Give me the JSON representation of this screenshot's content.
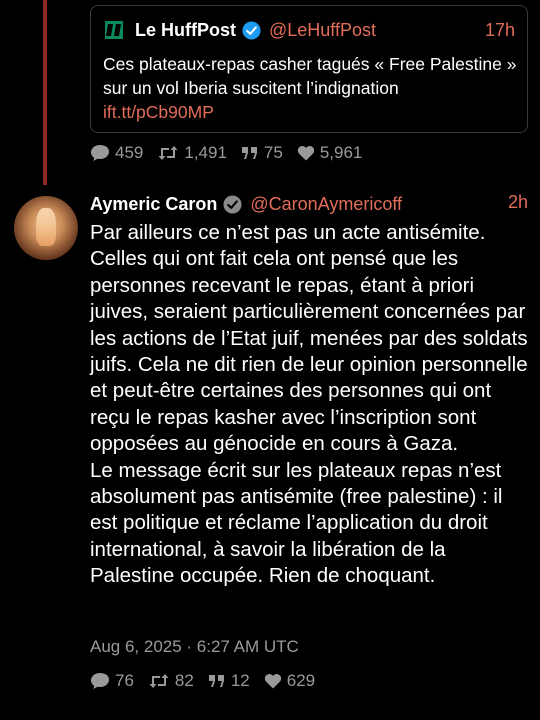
{
  "quoted": {
    "name": "Le HuffPost",
    "handle": "@LeHuffPost",
    "time": "17h",
    "text": "Ces plateaux-repas casher tagués « Free Palestine » sur un vol Iberia suscitent l’indignation",
    "link": "ift.tt/pCb90MP",
    "stats": {
      "replies": "459",
      "retweets": "1,491",
      "quotes": "75",
      "likes": "5,961"
    }
  },
  "post": {
    "name": "Aymeric Caron",
    "handle": "@CaronAymericoff",
    "time": "2h",
    "text": "Par ailleurs ce n’est pas un acte antisémite. Celles qui ont fait cela ont pensé que les personnes recevant le repas, étant à priori juives, seraient particulièrement concernées par les actions de l’Etat juif, menées par des soldats juifs. Cela ne dit rien de leur opinion personnelle et peut-être certaines des personnes qui ont reçu le repas kasher avec l’inscription sont opposées au génocide en cours à Gaza.\nLe message écrit sur les plateaux repas n’est absolument pas antisémite (free palestine) : il est politique et réclame l’application du droit international, à savoir la libération de la Palestine occupée. Rien de choquant.",
    "date": "Aug 6, 2025 · 6:27 AM UTC",
    "stats": {
      "replies": "76",
      "retweets": "82",
      "quotes": "12",
      "likes": "629"
    }
  },
  "icons": {
    "reply": "comment-icon",
    "retweet": "retweet-icon",
    "quote": "quote-icon",
    "like": "heart-icon",
    "verified_blue": "verified-badge-icon",
    "verified_grey": "verified-grey-badge-icon"
  },
  "colors": {
    "background": "#000000",
    "accent": "#e26d5a",
    "muted": "#9a9a9a",
    "thread_line": "#8a2a2a",
    "verified_blue": "#1d9bf0",
    "huffpost_green": "#0b8a5b"
  }
}
